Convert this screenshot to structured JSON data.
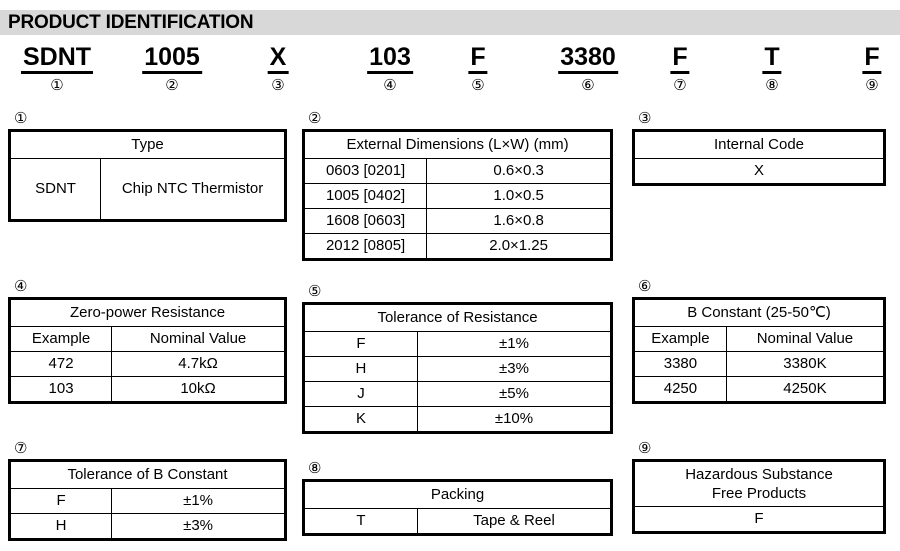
{
  "banner": {
    "title": "PRODUCT IDENTIFICATION"
  },
  "part_number": {
    "segments": [
      {
        "code": "SDNT",
        "marker": "①",
        "center": 57
      },
      {
        "code": "1005",
        "marker": "②",
        "center": 172
      },
      {
        "code": "X",
        "marker": "③",
        "center": 278
      },
      {
        "code": "103",
        "marker": "④",
        "center": 390
      },
      {
        "code": "F",
        "marker": "⑤",
        "center": 478
      },
      {
        "code": "3380",
        "marker": "⑥",
        "center": 588
      },
      {
        "code": "F",
        "marker": "⑦",
        "center": 680
      },
      {
        "code": "T",
        "marker": "⑧",
        "center": 772
      },
      {
        "code": "F",
        "marker": "⑨",
        "center": 872
      }
    ]
  },
  "blocks": {
    "type": {
      "marker": "①",
      "header": "Type",
      "rows": [
        [
          "SDNT",
          "Chip NTC Thermistor"
        ]
      ]
    },
    "dimensions": {
      "marker": "②",
      "header": "External Dimensions (L×W) (mm)",
      "rows": [
        [
          "0603 [0201]",
          "0.6×0.3"
        ],
        [
          "1005 [0402]",
          "1.0×0.5"
        ],
        [
          "1608 [0603]",
          "1.6×0.8"
        ],
        [
          "2012 [0805]",
          "2.0×1.25"
        ]
      ]
    },
    "internal_code": {
      "marker": "③",
      "header": "Internal Code",
      "rows": [
        [
          "X"
        ]
      ]
    },
    "resistance": {
      "marker": "④",
      "header": "Zero-power Resistance",
      "subheader": [
        "Example",
        "Nominal Value"
      ],
      "rows": [
        [
          "472",
          "4.7kΩ"
        ],
        [
          "103",
          "10kΩ"
        ]
      ]
    },
    "tolerance_resistance": {
      "marker": "⑤",
      "header": "Tolerance of Resistance",
      "rows": [
        [
          "F",
          "±1%"
        ],
        [
          "H",
          "±3%"
        ],
        [
          "J",
          "±5%"
        ],
        [
          "K",
          "±10%"
        ]
      ]
    },
    "b_constant": {
      "marker": "⑥",
      "header": "B Constant (25-50℃)",
      "subheader": [
        "Example",
        "Nominal Value"
      ],
      "rows": [
        [
          "3380",
          "3380K"
        ],
        [
          "4250",
          "4250K"
        ]
      ]
    },
    "tolerance_b_constant": {
      "marker": "⑦",
      "header": "Tolerance of B Constant",
      "rows": [
        [
          "F",
          "±1%"
        ],
        [
          "H",
          "±3%"
        ]
      ]
    },
    "packing": {
      "marker": "⑧",
      "header": "Packing",
      "rows": [
        [
          "T",
          "Tape & Reel"
        ]
      ]
    },
    "hazardous": {
      "marker": "⑨",
      "header_line1": "Hazardous Substance",
      "header_line2": "Free Products",
      "rows": [
        [
          "F"
        ]
      ]
    }
  }
}
